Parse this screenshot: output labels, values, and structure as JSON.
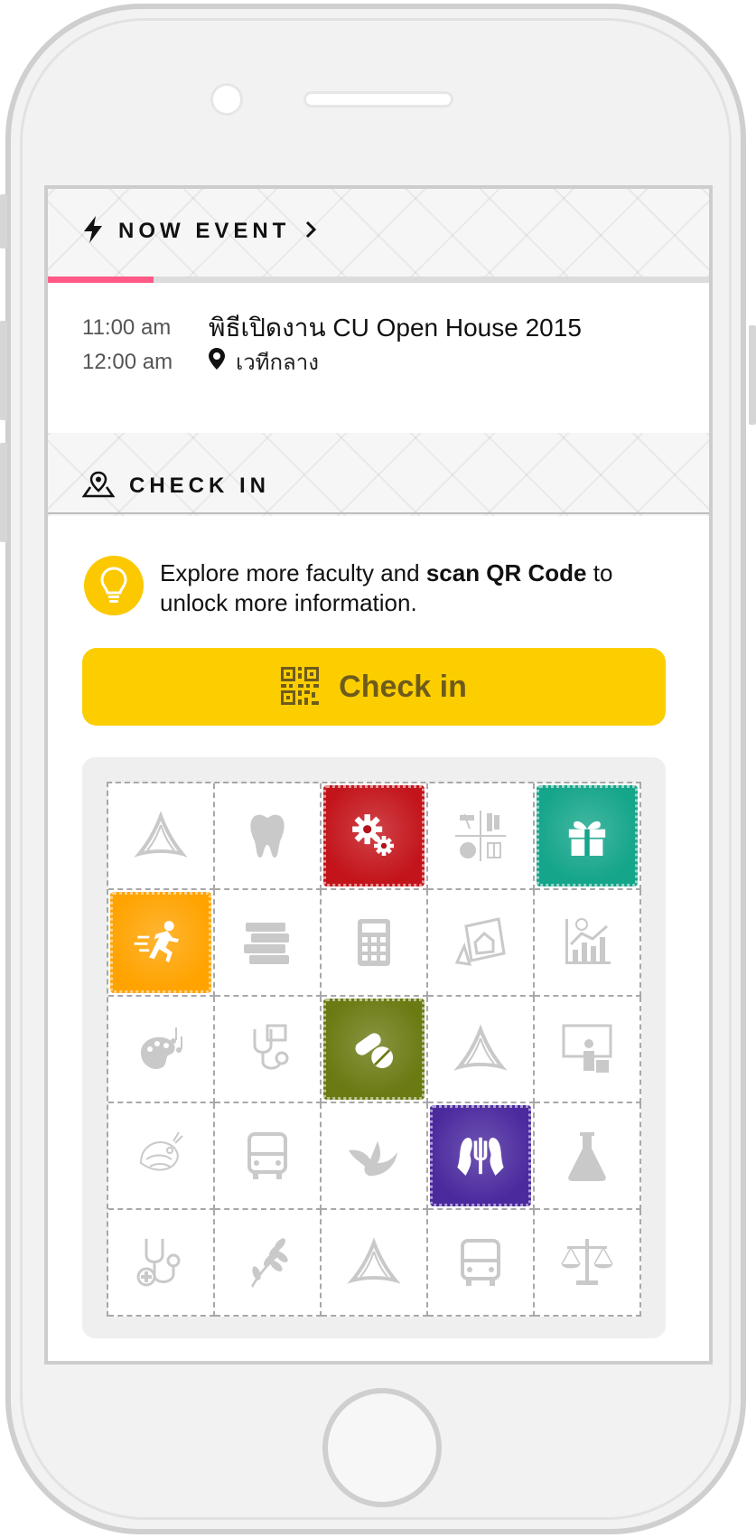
{
  "now_event": {
    "label": "NOW EVENT",
    "progress": 0.16,
    "start_time": "11:00 am",
    "end_time": "12:00 am",
    "title": "พิธีเปิดงาน CU Open House 2015",
    "location": "เวทีกลาง"
  },
  "check_in": {
    "section_label": "CHECK IN",
    "tip_part1": "Explore more faculty and ",
    "tip_bold": "scan QR Code",
    "tip_part2": " to unlock more information.",
    "button_label": "Check in"
  },
  "colors": {
    "accent_yellow": "#fcce00",
    "progress_pink": "#ff5a85",
    "stamp_engineering": "#c3141b",
    "stamp_gift": "#14a58a",
    "stamp_sport": "#ffa300",
    "stamp_pharmacy": "#6b7a12",
    "stamp_psychology": "#4b2a9e"
  },
  "grid": {
    "cells": [
      {
        "icon": "triangle-icon",
        "collected": false
      },
      {
        "icon": "tooth-icon",
        "collected": false
      },
      {
        "icon": "gears-icon",
        "collected": true,
        "color": "#c3141b"
      },
      {
        "icon": "science-collage-icon",
        "collected": false
      },
      {
        "icon": "gift-icon",
        "collected": true,
        "color": "#14a58a"
      },
      {
        "icon": "runner-icon",
        "collected": true,
        "color": "#ffa300"
      },
      {
        "icon": "books-icon",
        "collected": false
      },
      {
        "icon": "calculator-icon",
        "collected": false
      },
      {
        "icon": "architecture-icon",
        "collected": false
      },
      {
        "icon": "chart-icon",
        "collected": false
      },
      {
        "icon": "art-palette-icon",
        "collected": false
      },
      {
        "icon": "stethoscope-icon",
        "collected": false
      },
      {
        "icon": "pills-icon",
        "collected": true,
        "color": "#6b7a12"
      },
      {
        "icon": "triangle-icon",
        "collected": false
      },
      {
        "icon": "teacher-icon",
        "collected": false
      },
      {
        "icon": "dragon-icon",
        "collected": false
      },
      {
        "icon": "bus-icon",
        "collected": false
      },
      {
        "icon": "dove-icon",
        "collected": false
      },
      {
        "icon": "psychology-icon",
        "collected": true,
        "color": "#4b2a9e"
      },
      {
        "icon": "flask-icon",
        "collected": false
      },
      {
        "icon": "stethoscope-cross-icon",
        "collected": false
      },
      {
        "icon": "wheat-icon",
        "collected": false
      },
      {
        "icon": "triangle-icon",
        "collected": false
      },
      {
        "icon": "bus-icon",
        "collected": false
      },
      {
        "icon": "scales-icon",
        "collected": false
      }
    ]
  }
}
